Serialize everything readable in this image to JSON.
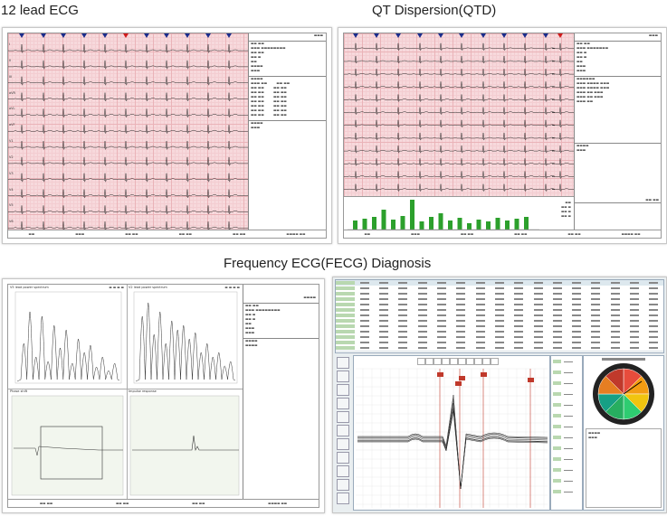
{
  "titles": {
    "ecg12": "12 lead ECG",
    "qtd": "QT Dispersion(QTD)",
    "fecg": "Frequency ECG(FECG) Diagnosis"
  },
  "colors": {
    "grid_bg": "#f7d9dc",
    "grid_major": "#eab3b8",
    "marker_blue": "#1a2c8c",
    "marker_red": "#d01a1a",
    "bar_green": "#2ca02c",
    "trace": "#222222",
    "plot_bg": "#f2f6ee"
  },
  "ecg12_panel": {
    "lead_labels": [
      "I",
      "II",
      "III",
      "aVR",
      "aVL",
      "aVF",
      "V1",
      "V2",
      "V3",
      "V4",
      "V5",
      "V6"
    ]
  },
  "fecg_panel": {
    "plot1_title": "V5 lead power spectrum",
    "plot2_title": "V2 lead power spectrum",
    "plot3_title": "Phase shift",
    "plot4_title": "Impulse response"
  },
  "fecg_analysis": {
    "toolbar_labels": [
      "P",
      "Q",
      "R",
      "S",
      "T"
    ]
  }
}
